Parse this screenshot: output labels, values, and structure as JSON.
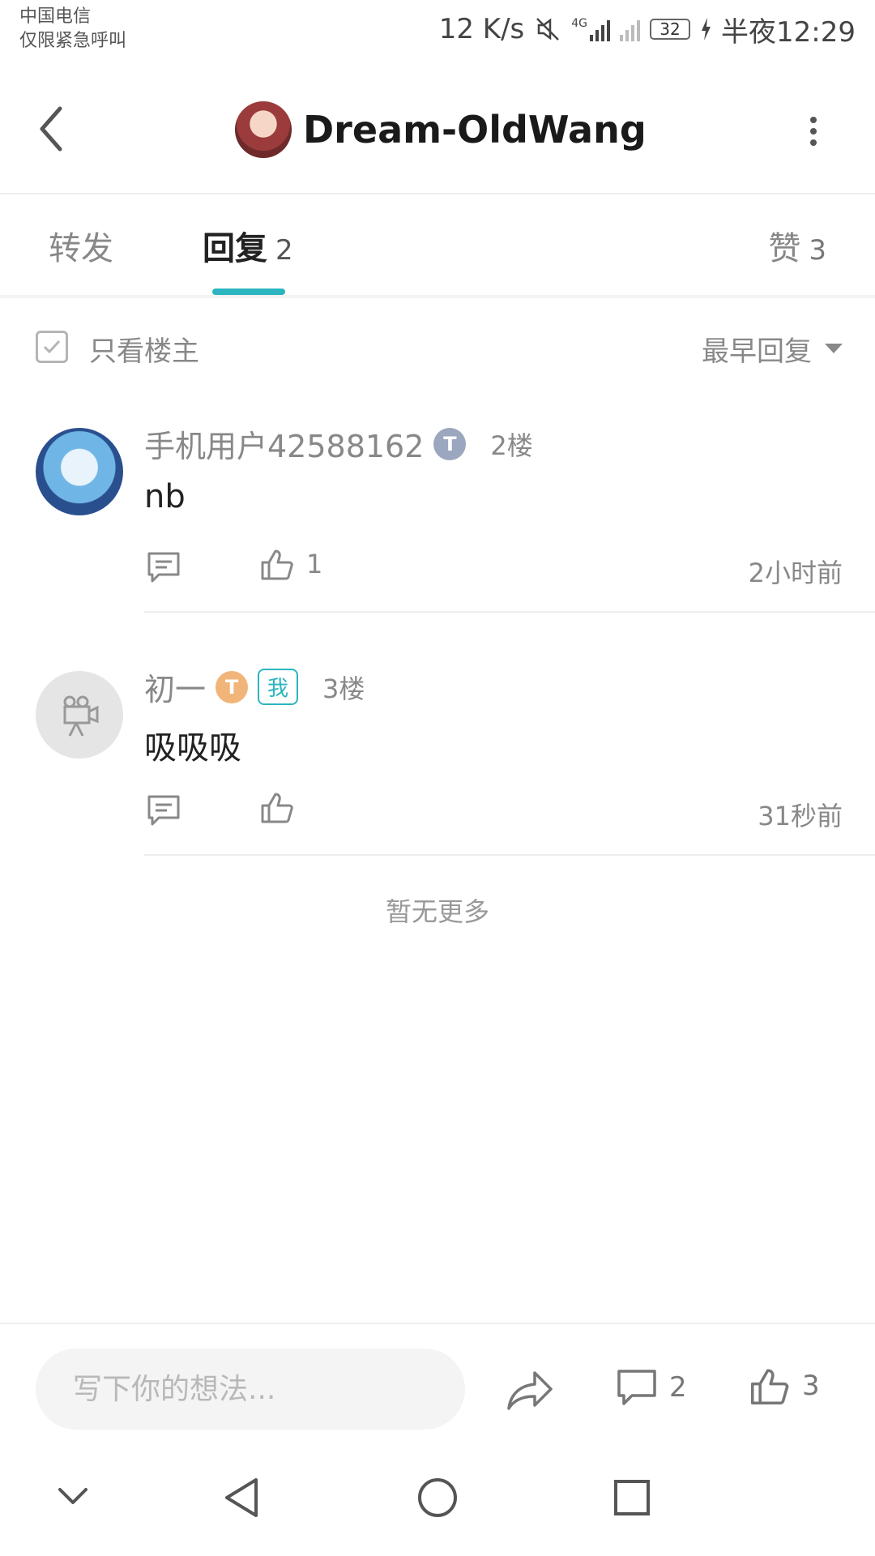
{
  "status": {
    "carrier_line1": "中国电信",
    "carrier_line2": "仅限紧急呼叫",
    "speed": "12 K/s",
    "network": "4G",
    "battery": "32",
    "time": "半夜12:29"
  },
  "header": {
    "title": "Dream-OldWang",
    "back_icon": "chevron-left-icon",
    "more_icon": "more-vertical-icon"
  },
  "tabs": {
    "forward_label": "转发",
    "reply_label": "回复",
    "reply_count": "2",
    "like_label": "赞",
    "like_count": "3",
    "accent": "#2bb5c0"
  },
  "filter": {
    "only_op_label": "只看楼主",
    "sort_label": "最早回复"
  },
  "comments": [
    {
      "username": "手机用户42588162",
      "badge": "T",
      "floor": "2楼",
      "text": "nb",
      "likes": "1",
      "time": "2小时前"
    },
    {
      "username": "初一",
      "badge": "T",
      "me_tag": "我",
      "floor": "3楼",
      "text": "吸吸吸",
      "likes": "",
      "time": "31秒前"
    }
  ],
  "no_more": "暂无更多",
  "bottom": {
    "input_placeholder": "写下你的想法...",
    "comment_count": "2",
    "like_count": "3"
  },
  "nav": {
    "icons": [
      "collapse-icon",
      "back-triangle-icon",
      "home-circle-icon",
      "recents-square-icon"
    ]
  }
}
